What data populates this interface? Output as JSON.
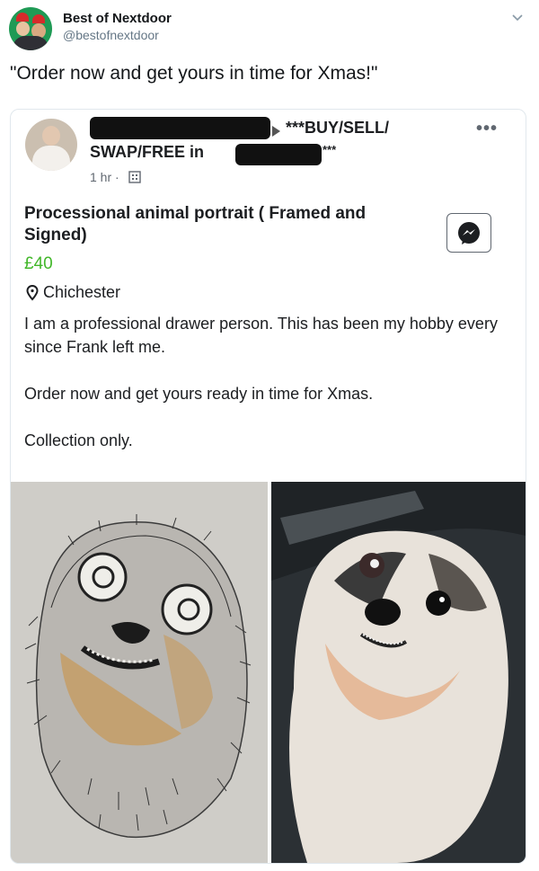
{
  "tweet": {
    "author_name": "Best of Nextdoor",
    "author_handle": "@bestofnextdoor",
    "text": "\"Order now and get yours in time for Xmas!\""
  },
  "post": {
    "group_line1": "***BUY/SELL/",
    "group_line2": "SWAP/FREE in",
    "group_line2_stars": "***",
    "time": "1 hr ·",
    "title": "Processional animal portrait ( Framed and Signed)",
    "price": "£40",
    "location": "Chichester",
    "description": [
      "I am a professional drawer person. This has been my hobby  every since Frank left me.",
      "Order now and get yours ready in time for Xmas.",
      "Collection only."
    ]
  },
  "icons": {
    "chevron": "chevron-down-icon",
    "more": "more-options-icon",
    "messenger": "messenger-icon",
    "location": "location-pin-icon",
    "privacy": "group-privacy-icon"
  },
  "colors": {
    "price": "#42b72a",
    "handle": "#657786",
    "meta": "#606770"
  }
}
